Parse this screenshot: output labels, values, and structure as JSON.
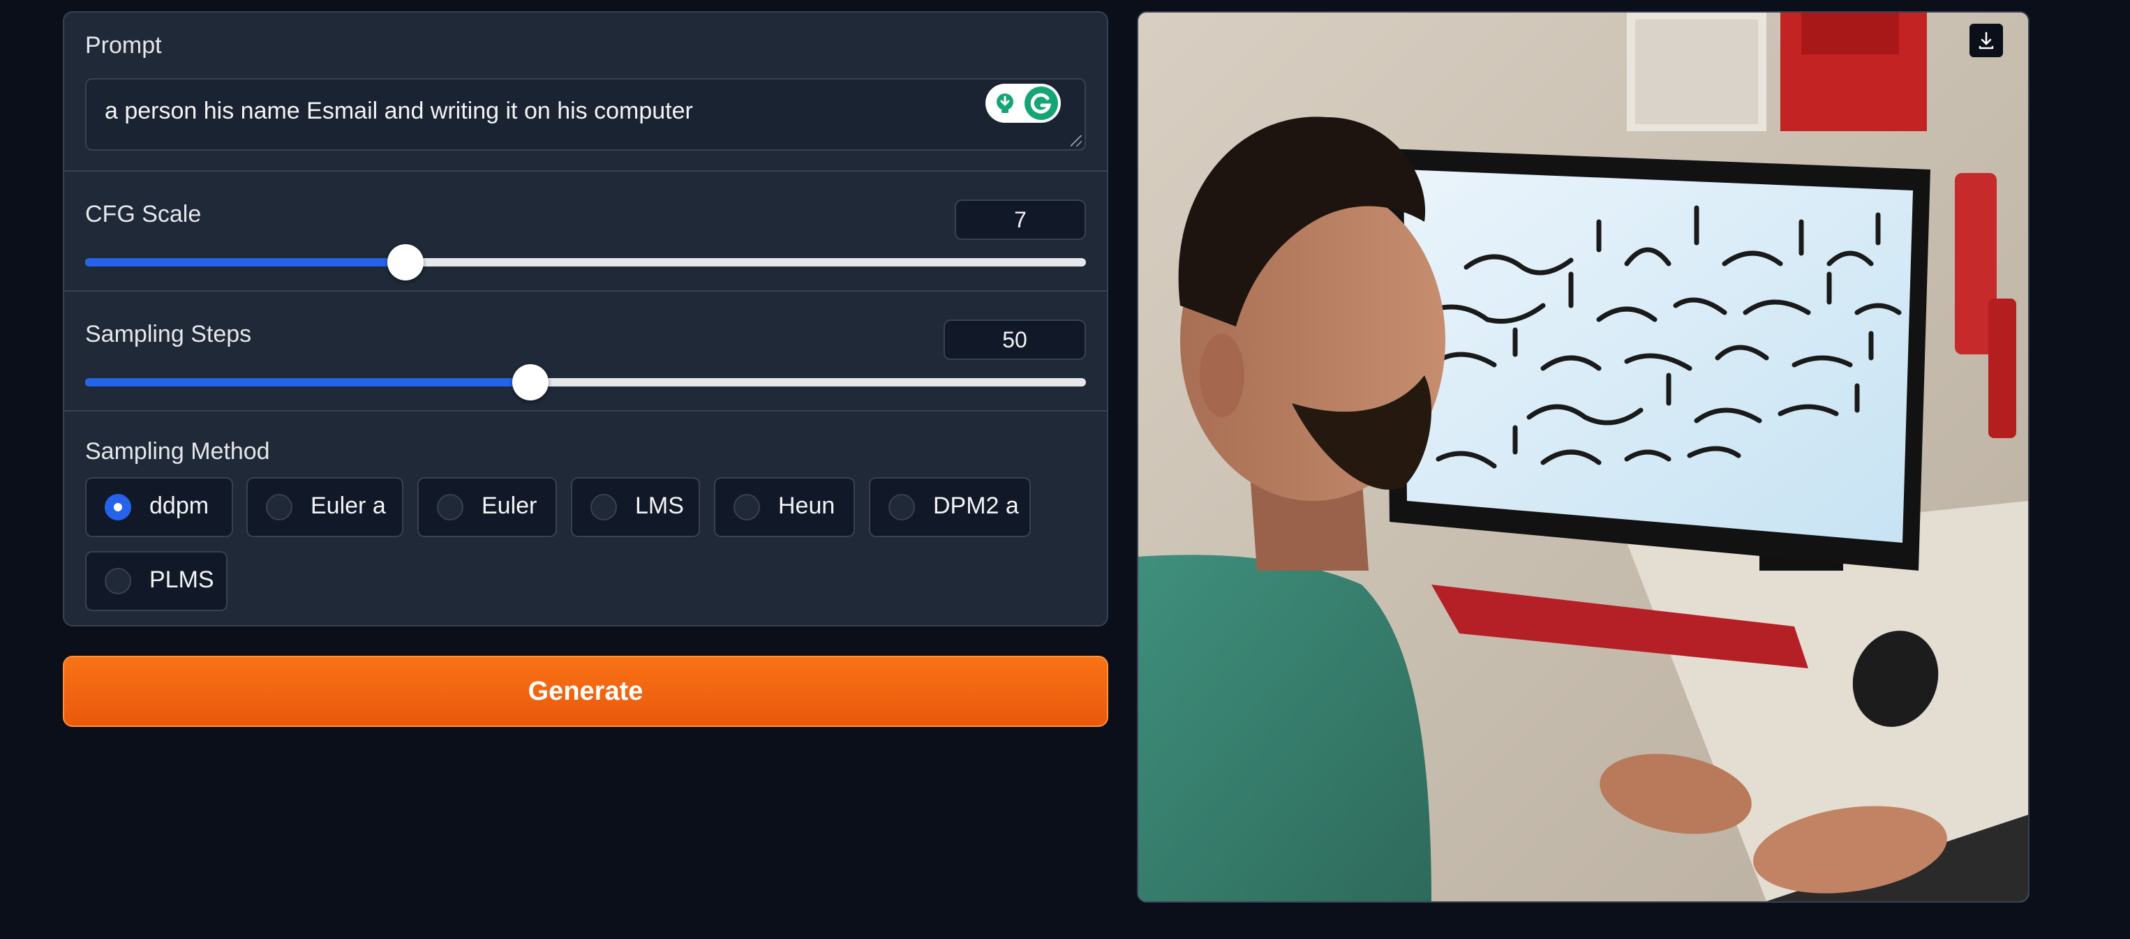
{
  "prompt": {
    "label": "Prompt",
    "value": "a person his name Esmail and writing it on his computer"
  },
  "cfg": {
    "label": "CFG Scale",
    "value": "7",
    "fraction": 0.32
  },
  "steps": {
    "label": "Sampling Steps",
    "value": "50",
    "fraction": 0.445
  },
  "method": {
    "label": "Sampling Method",
    "selected": "ddpm",
    "options": [
      "ddpm",
      "Euler a",
      "Euler",
      "LMS",
      "Heun",
      "DPM2 a",
      "PLMS"
    ]
  },
  "generate_label": "Generate",
  "icons": {
    "download": "download-icon",
    "grammarly": "grammarly-icon",
    "bulb": "lightbulb-icon"
  },
  "colors": {
    "accent": "#2563eb",
    "primary_button": "#f97316",
    "background": "#0b0f19",
    "panel": "#1f2937"
  }
}
